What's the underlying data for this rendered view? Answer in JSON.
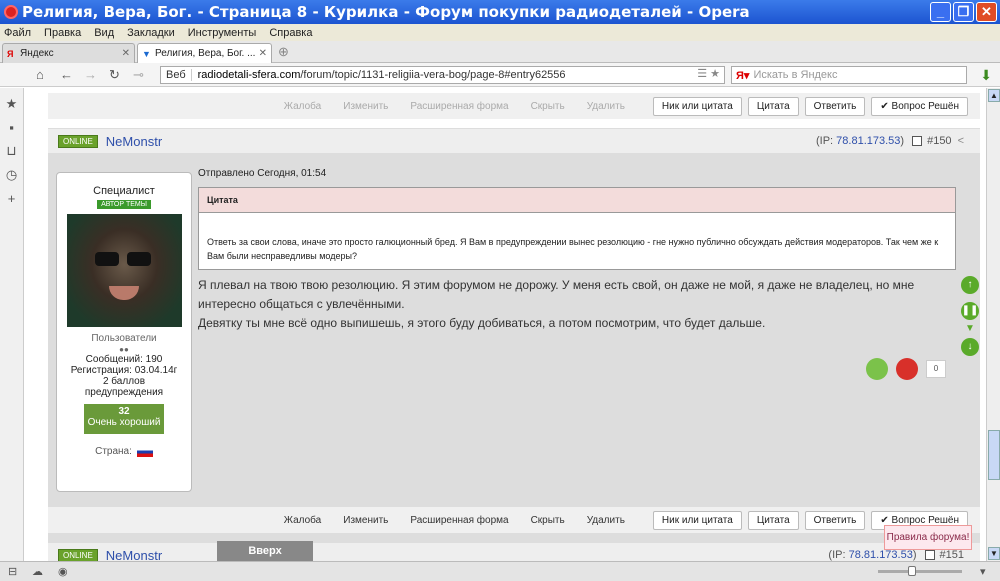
{
  "window": {
    "title": "Религия, Вера, Бог. - Страница 8 - Курилка - Форум покупки радиодеталей - Opera"
  },
  "menu": [
    "Файл",
    "Правка",
    "Вид",
    "Закладки",
    "Инструменты",
    "Справка"
  ],
  "tabs": [
    {
      "label": "Яндекс"
    },
    {
      "label": "Религия, Вера, Бог. ..."
    }
  ],
  "address": {
    "mode": "Веб",
    "host": "radiodetali-sfera.com",
    "path": "/forum/topic/1131-religiia-vera-bog/page-8#entry62556"
  },
  "search": {
    "placeholder": "Искать в Яндекс"
  },
  "actions": {
    "complain": "Жалоба",
    "edit": "Изменить",
    "extended": "Расширенная форма",
    "hide": "Скрыть",
    "delete": "Удалить",
    "nick_quote": "Ник или цитата",
    "quote": "Цитата",
    "reply": "Ответить",
    "solved": "✔ Вопрос Решён"
  },
  "post": {
    "online": "ONLINE",
    "author": "NeMonstr",
    "ip_label": "(IP:",
    "ip": "78.81.173.53",
    "ip_close": ")",
    "number": "#150",
    "sent": "Отправлено Сегодня, 01:54",
    "quote_title": "Цитата",
    "quote_text": "Ответь за свои слова, иначе это просто галюционный бред. Я Вам в предупреждении вынес резолюцию - гне нужно публично обсуждать действия модераторов. Так чем же к Вам были несправедливы модеры?",
    "body_1": "Я плевал на твою твою резолюцию. Я этим форумом не дорожу. У меня есть свой, он даже не мой, я даже не владелец, но мне интересно общаться с увлечёнными.",
    "body_2": "Девятку ты мне всё одно выпишешь, я этого буду добиваться, а потом посмотрим, что будет дальше.",
    "votes": "0"
  },
  "user": {
    "role": "Специалист",
    "badge": "АВТОР ТЕМЫ",
    "group": "Пользователи",
    "pips": "●●",
    "messages": "Сообщений: 190",
    "registered": "Регистрация: 03.04.14г",
    "warnings_1": "2 баллов",
    "warnings_2": "предупреждения",
    "rep_value": "32",
    "rep_label": "Очень хороший",
    "country": "Страна:"
  },
  "next_post": {
    "online": "ONLINE",
    "author": "NeMonstr",
    "ip": "78.81.173.53",
    "number": "#151"
  },
  "overlays": {
    "top_button": "Вверх",
    "rules": "Правила форума!"
  }
}
